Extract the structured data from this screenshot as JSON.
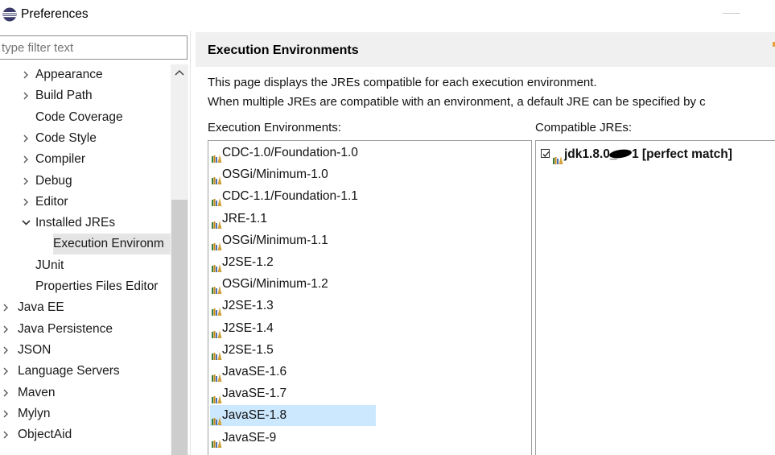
{
  "window": {
    "title": "Preferences"
  },
  "filter": {
    "placeholder": "type filter text"
  },
  "tree": {
    "items": [
      {
        "label": "Appearance",
        "expander": "collapsed",
        "selected": false
      },
      {
        "label": "Build Path",
        "expander": "collapsed",
        "selected": false
      },
      {
        "label": "Code Coverage",
        "expander": "none",
        "selected": false
      },
      {
        "label": "Code Style",
        "expander": "collapsed",
        "selected": false
      },
      {
        "label": "Compiler",
        "expander": "collapsed",
        "selected": false
      },
      {
        "label": "Debug",
        "expander": "collapsed",
        "selected": false
      },
      {
        "label": "Editor",
        "expander": "collapsed",
        "selected": false
      },
      {
        "label": "Installed JREs",
        "expander": "expanded",
        "selected": false
      },
      {
        "label": "Execution Environm",
        "expander": "none",
        "selected": true
      },
      {
        "label": "JUnit",
        "expander": "none",
        "selected": false
      },
      {
        "label": "Properties Files Editor",
        "expander": "none",
        "selected": false
      },
      {
        "label": "Java EE",
        "expander": "collapsed",
        "selected": false
      },
      {
        "label": "Java Persistence",
        "expander": "collapsed",
        "selected": false
      },
      {
        "label": "JSON",
        "expander": "collapsed",
        "selected": false
      },
      {
        "label": "Language Servers",
        "expander": "collapsed",
        "selected": false
      },
      {
        "label": "Maven",
        "expander": "collapsed",
        "selected": false
      },
      {
        "label": "Mylyn",
        "expander": "collapsed",
        "selected": false
      },
      {
        "label": "ObjectAid",
        "expander": "collapsed",
        "selected": false
      }
    ]
  },
  "page": {
    "title": "Execution Environments",
    "description_line1": "This page displays the JREs compatible for each execution environment.",
    "description_line2": "When multiple JREs are compatible with an environment, a default JRE can be specified by c"
  },
  "environments": {
    "label": "Execution Environments:",
    "items": [
      {
        "name": "CDC-1.0/Foundation-1.0",
        "selected": false
      },
      {
        "name": "OSGi/Minimum-1.0",
        "selected": false
      },
      {
        "name": "CDC-1.1/Foundation-1.1",
        "selected": false
      },
      {
        "name": "JRE-1.1",
        "selected": false
      },
      {
        "name": "OSGi/Minimum-1.1",
        "selected": false
      },
      {
        "name": "J2SE-1.2",
        "selected": false
      },
      {
        "name": "OSGi/Minimum-1.2",
        "selected": false
      },
      {
        "name": "J2SE-1.3",
        "selected": false
      },
      {
        "name": "J2SE-1.4",
        "selected": false
      },
      {
        "name": "J2SE-1.5",
        "selected": false
      },
      {
        "name": "JavaSE-1.6",
        "selected": false
      },
      {
        "name": "JavaSE-1.7",
        "selected": false
      },
      {
        "name": "JavaSE-1.8",
        "selected": true
      },
      {
        "name": "JavaSE-9",
        "selected": false
      }
    ]
  },
  "jres": {
    "label": "Compatible JREs:",
    "items": [
      {
        "name_prefix": "jdk1.8.0_",
        "name_suffix": "1 [perfect match]",
        "checked": true
      }
    ]
  },
  "colors": {
    "selection": "#cce8ff",
    "tree_selection": "#e5e5e5",
    "header_bg": "#f0f0f0",
    "border": "#a0a0a0"
  },
  "icons": {
    "app": "eclipse-icon",
    "environment": "jre-library-icon",
    "expander_collapsed": "chevron-right-icon",
    "expander_expanded": "chevron-down-icon"
  }
}
